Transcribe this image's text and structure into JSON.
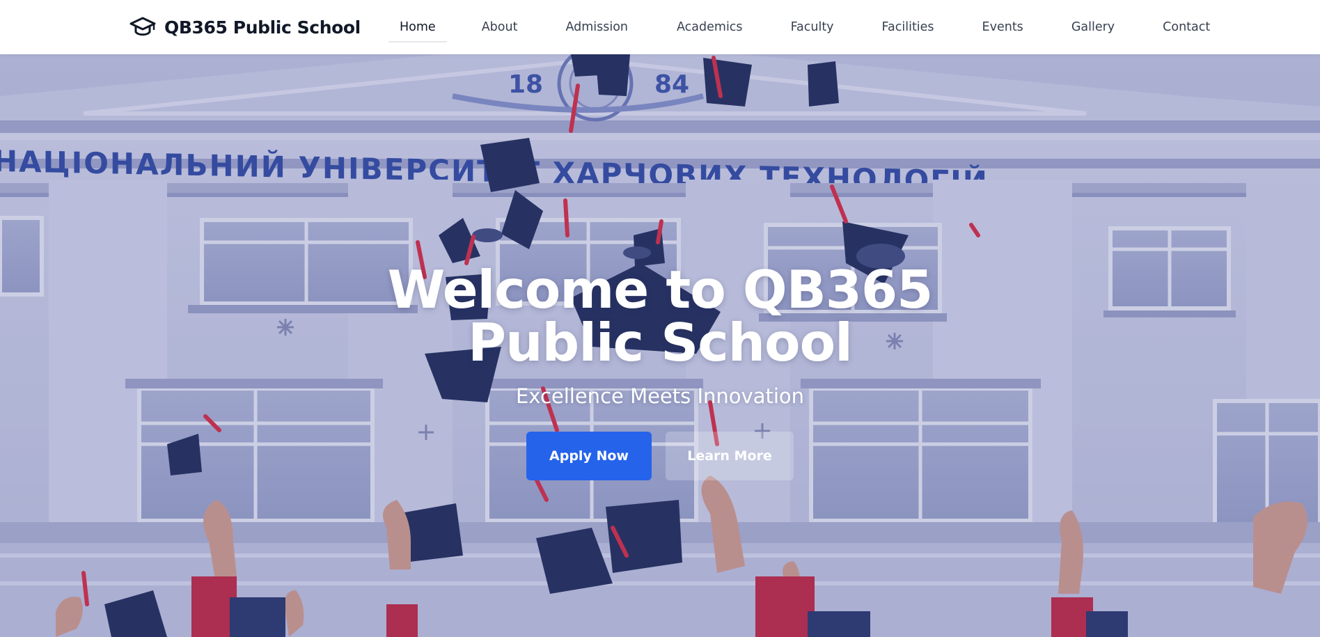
{
  "brand": {
    "icon": "graduation-cap-icon",
    "name": "QB365 Public School"
  },
  "nav": {
    "items": [
      {
        "label": "Home",
        "active": true
      },
      {
        "label": "About",
        "active": false
      },
      {
        "label": "Admission",
        "active": false
      },
      {
        "label": "Academics",
        "active": false
      },
      {
        "label": "Faculty",
        "active": false
      },
      {
        "label": "Facilities",
        "active": false
      },
      {
        "label": "Events",
        "active": false
      },
      {
        "label": "Gallery",
        "active": false
      },
      {
        "label": "Contact",
        "active": false
      }
    ]
  },
  "hero": {
    "title": "Welcome to QB365 Public School",
    "subtitle": "Excellence Meets Innovation",
    "primary_button": "Apply Now",
    "secondary_button": "Learn More",
    "building_sign": "НАЦІОНАЛЬНИЙ УНІВЕРСИТЕТ ХАРЧОВИХ ТЕХНОЛОГІЙ",
    "pediment_year_left": "18",
    "pediment_year_right": "84"
  },
  "colors": {
    "primary": "#2563eb",
    "nav_text": "#374151",
    "brand_text": "#111827",
    "overlay": "#4a52a0",
    "cap": "#1e2a52",
    "tassel": "#e0283a",
    "sign": "#2f4aa0"
  }
}
